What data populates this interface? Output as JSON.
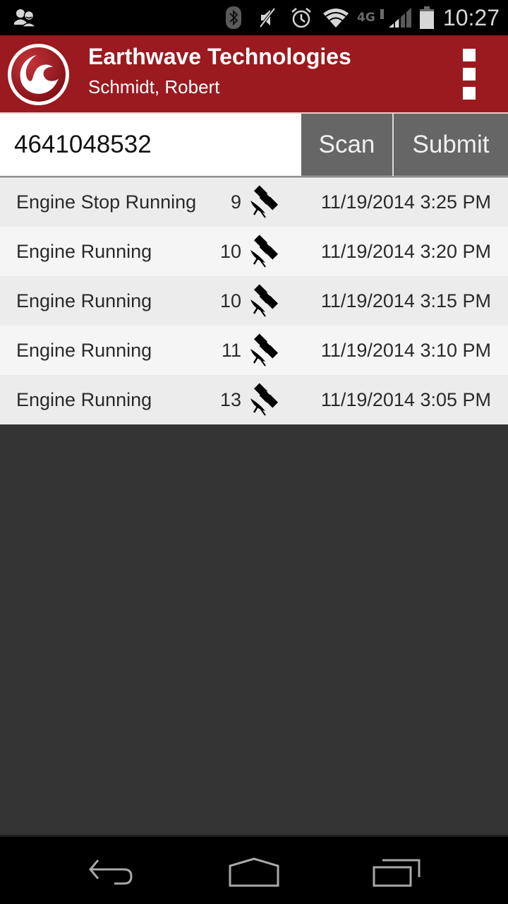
{
  "status_bar": {
    "time": "10:27",
    "icons": [
      "contacts-sync-icon",
      "bluetooth-icon",
      "muted-icon",
      "alarm-icon",
      "wifi-icon",
      "4g-lte-icon",
      "signal-icon",
      "battery-icon"
    ],
    "network_label": "4G"
  },
  "app_bar": {
    "title": "Earthwave Technologies",
    "subtitle": "Schmidt, Robert",
    "logo_icon": "earthwave-logo-icon",
    "menu_icon": "overflow-menu-icon",
    "brand_color": "#9a1a1f"
  },
  "input_row": {
    "value": "4641048532",
    "placeholder": "",
    "scan_label": "Scan",
    "submit_label": "Submit"
  },
  "events": [
    {
      "label": "Engine Stop Running",
      "count": "9",
      "icon": "gps-satellite-off-icon",
      "time": "11/19/2014 3:25 PM"
    },
    {
      "label": "Engine Running",
      "count": "10",
      "icon": "gps-satellite-off-icon",
      "time": "11/19/2014 3:20 PM"
    },
    {
      "label": "Engine Running",
      "count": "10",
      "icon": "gps-satellite-off-icon",
      "time": "11/19/2014 3:15 PM"
    },
    {
      "label": "Engine Running",
      "count": "11",
      "icon": "gps-satellite-off-icon",
      "time": "11/19/2014 3:10 PM"
    },
    {
      "label": "Engine Running",
      "count": "13",
      "icon": "gps-satellite-off-icon",
      "time": "11/19/2014 3:05 PM"
    }
  ],
  "nav_bar": {
    "back": "back-icon",
    "home": "home-icon",
    "recents": "recent-apps-icon"
  }
}
